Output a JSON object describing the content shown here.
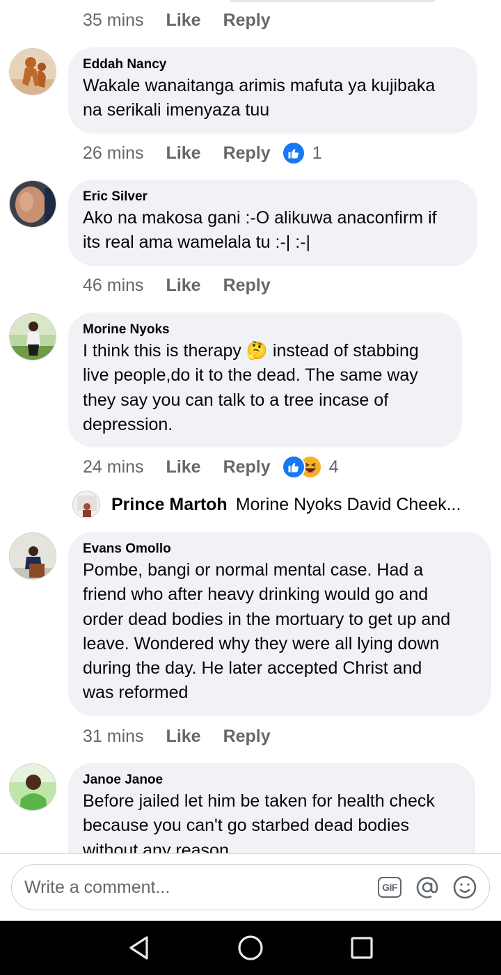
{
  "top_meta": {
    "time": "35 mins",
    "like": "Like",
    "reply": "Reply"
  },
  "comments": [
    {
      "name": "Eddah Nancy",
      "text": "Wakale wanaitanga arimis mafuta ya kujibaka\nna serikali imenyaza tuu",
      "time": "26 mins",
      "like": "Like",
      "reply": "Reply",
      "reactions": [
        "like"
      ],
      "reaction_count": "1"
    },
    {
      "name": "Eric Silver",
      "text": "Ako na makosa gani :-O alikuwa anaconfirm if\nits real ama wamelala tu :-| :-|",
      "time": "46 mins",
      "like": "Like",
      "reply": "Reply"
    },
    {
      "name": "Morine Nyoks",
      "text_before_emoji": "I think this is therapy ",
      "emoji": "🤔",
      "text_after_emoji": " instead of stabbing\nlive people,do it to the dead. The same way\nthey say you can talk to a tree incase of\ndepression.",
      "time": "24 mins",
      "like": "Like",
      "reply": "Reply",
      "reactions": [
        "like",
        "haha"
      ],
      "reaction_count": "4"
    },
    {
      "name": "Evans Omollo",
      "text": "Pombe, bangi or normal mental case. Had a\nfriend who after heavy drinking would go and\norder dead bodies in the mortuary to get up and\nleave. Wondered why they were all lying down\nduring the day. He later accepted Christ and\nwas reformed",
      "time": "31 mins",
      "like": "Like",
      "reply": "Reply"
    },
    {
      "name": "Janoe Janoe",
      "text": "Before jailed let him be taken for health check\nbecause you can't go starbed dead bodies\nwithout any reason"
    }
  ],
  "reply_preview": {
    "name": "Prince Martoh",
    "text": "Morine Nyoks David Cheek..."
  },
  "composer": {
    "placeholder": "Write a comment...",
    "gif_label": "GIF"
  },
  "icons": {
    "like_color": "#1877f2",
    "haha_color": "#f7b125",
    "gif": "gif-icon",
    "mention": "at-icon",
    "emoji": "smiley-icon",
    "nav": [
      "back-icon",
      "home-icon",
      "recents-icon"
    ]
  }
}
